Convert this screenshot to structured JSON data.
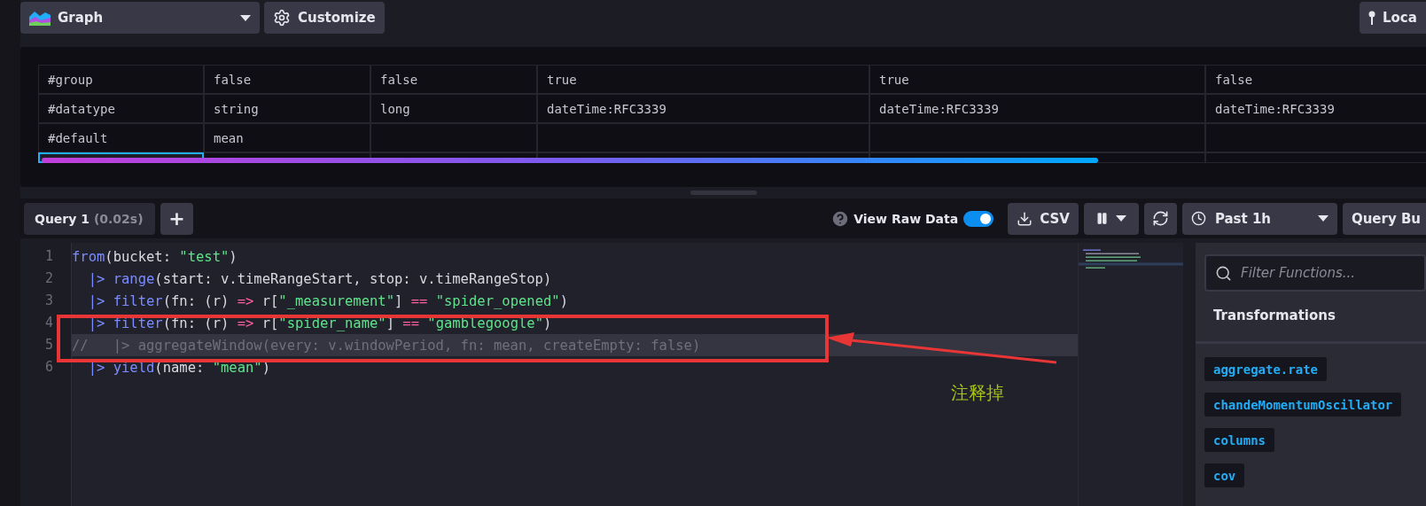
{
  "toolbar": {
    "visualization": "Graph",
    "customize": "Customize",
    "local": "Loca"
  },
  "table": {
    "rows": [
      {
        "cells": [
          "#group",
          "false",
          "false",
          "true",
          "true",
          "false"
        ]
      },
      {
        "cells": [
          "#datatype",
          "string",
          "long",
          "dateTime:RFC3339",
          "dateTime:RFC3339",
          "dateTime:RFC3339"
        ]
      },
      {
        "cells": [
          "#default",
          "mean",
          null,
          null,
          null,
          null
        ]
      }
    ],
    "partial_row": {
      "cells": [
        {
          "selected": true
        },
        {
          "selected": false
        },
        {
          "selected": false
        },
        {
          "selected": false
        },
        {
          "selected": false
        },
        {
          "selected": false
        }
      ]
    }
  },
  "query_bar": {
    "tabs": [
      {
        "label": "Query 1",
        "timing": "(0.02s)",
        "selected": true
      }
    ],
    "add": "+",
    "raw_data_label": "View Raw Data",
    "raw_data_on": true,
    "csv": "CSV",
    "time_range": "Past 1h",
    "query_builder": "Query Bu"
  },
  "editor": {
    "lines": [
      {
        "number": "1",
        "current": false,
        "tokens": [
          {
            "kind": "func",
            "text": "from"
          },
          {
            "kind": "plain",
            "text": "(bucket: "
          },
          {
            "kind": "string",
            "text": "\"test\""
          },
          {
            "kind": "plain",
            "text": ")"
          }
        ]
      },
      {
        "number": "2",
        "current": false,
        "tokens": [
          {
            "kind": "pipe",
            "text": "  |> "
          },
          {
            "kind": "func",
            "text": "range"
          },
          {
            "kind": "plain",
            "text": "(start: v.timeRangeStart, stop: v.timeRangeStop)"
          }
        ]
      },
      {
        "number": "3",
        "current": false,
        "tokens": [
          {
            "kind": "pipe",
            "text": "  |> "
          },
          {
            "kind": "func",
            "text": "filter"
          },
          {
            "kind": "plain",
            "text": "(fn: (r) "
          },
          {
            "kind": "op",
            "text": "=>"
          },
          {
            "kind": "plain",
            "text": " r["
          },
          {
            "kind": "string",
            "text": "\"_measurement\""
          },
          {
            "kind": "plain",
            "text": "]"
          },
          {
            "kind": "op",
            "text": " == "
          },
          {
            "kind": "string",
            "text": "\"spider_opened\""
          },
          {
            "kind": "plain",
            "text": ")"
          }
        ]
      },
      {
        "number": "4",
        "current": false,
        "tokens": [
          {
            "kind": "pipe",
            "text": "  |> "
          },
          {
            "kind": "func",
            "text": "filter"
          },
          {
            "kind": "plain",
            "text": "(fn: (r) "
          },
          {
            "kind": "op",
            "text": "=>"
          },
          {
            "kind": "plain",
            "text": " r["
          },
          {
            "kind": "string",
            "text": "\"spider_name\""
          },
          {
            "kind": "plain",
            "text": "]"
          },
          {
            "kind": "op",
            "text": " == "
          },
          {
            "kind": "string",
            "text": "\"gamblegoogle\""
          },
          {
            "kind": "plain",
            "text": ")"
          }
        ]
      },
      {
        "number": "5",
        "current": true,
        "tokens": [
          {
            "kind": "comment",
            "text": "//   |> aggregateWindow(every: v.windowPeriod, fn: mean, createEmpty: false)"
          }
        ]
      },
      {
        "number": "6",
        "current": false,
        "tokens": [
          {
            "kind": "pipe",
            "text": "  |> "
          },
          {
            "kind": "func",
            "text": "yield"
          },
          {
            "kind": "plain",
            "text": "(name: "
          },
          {
            "kind": "string",
            "text": "\"mean\""
          },
          {
            "kind": "plain",
            "text": ")"
          }
        ]
      }
    ]
  },
  "functions": {
    "placeholder": "Filter Functions...",
    "heading": "Transformations",
    "items": [
      "aggregate.rate",
      "chandeMomentumOscillator",
      "columns",
      "cov"
    ]
  },
  "annotation": {
    "note": "注释掉"
  }
}
